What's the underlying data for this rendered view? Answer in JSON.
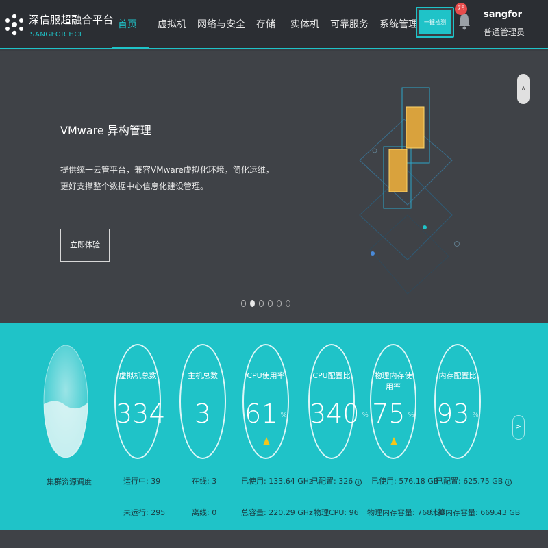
{
  "brand": {
    "name_cn": "深信服超融合平台",
    "name_en": "SANGFOR HCI"
  },
  "nav": {
    "items": [
      {
        "label": "首页",
        "active": true
      },
      {
        "label": "虚拟机",
        "active": false
      },
      {
        "label": "网络与安全",
        "active": false
      },
      {
        "label": "存储",
        "active": false
      },
      {
        "label": "实体机",
        "active": false
      },
      {
        "label": "可靠服务",
        "active": false
      },
      {
        "label": "系统管理",
        "active": false
      }
    ]
  },
  "header": {
    "check_label": "一键检测",
    "notification_count": "75",
    "user_name": "sangfor",
    "user_role": "普通管理员"
  },
  "banner": {
    "title": "VMware 异构管理",
    "description": "提供统一云管平台，兼容VMware虚拟化环境，简化运维，更好支撑整个数据中心信息化建设管理。",
    "button_label": "立即体验",
    "collapse_icon": "chevron-up-icon",
    "slides": 6,
    "active_slide": 1
  },
  "stats": {
    "cluster_label": "集群资源调度",
    "gauges": [
      {
        "title": "虚拟机总数",
        "value": "334",
        "unit": "",
        "warning": false,
        "line1": "运行中: 39",
        "line2": "未运行: 295"
      },
      {
        "title": "主机总数",
        "value": "3",
        "unit": "",
        "warning": false,
        "line1": "在线: 3",
        "line2": "离线: 0"
      },
      {
        "title": "CPU使用率",
        "value": "61",
        "unit": "%",
        "warning": true,
        "line1": "已使用: 133.64 GHz",
        "line2": "总容量: 220.29 GHz"
      },
      {
        "title": "CPU配置比",
        "value": "340",
        "unit": "%",
        "warning": false,
        "line1": "已配置: 326",
        "line2": "物理CPU: 96",
        "info": true
      },
      {
        "title": "物理内存使用率",
        "value": "75",
        "unit": "%",
        "warning": true,
        "line1": "已使用: 576.18 GB",
        "line2": "物理内存容量: 768 GB"
      },
      {
        "title": "内存配置比",
        "value": "93",
        "unit": "%",
        "warning": false,
        "line1": "已配置: 625.75 GB",
        "line2": "计算内存容量: 669.43 GB",
        "info": true
      }
    ]
  },
  "colors": {
    "accent": "#1fc3c8",
    "topbar": "#2b2e33",
    "banner": "#3f4247",
    "warning": "#f5c518",
    "badge": "#e74c4c"
  }
}
